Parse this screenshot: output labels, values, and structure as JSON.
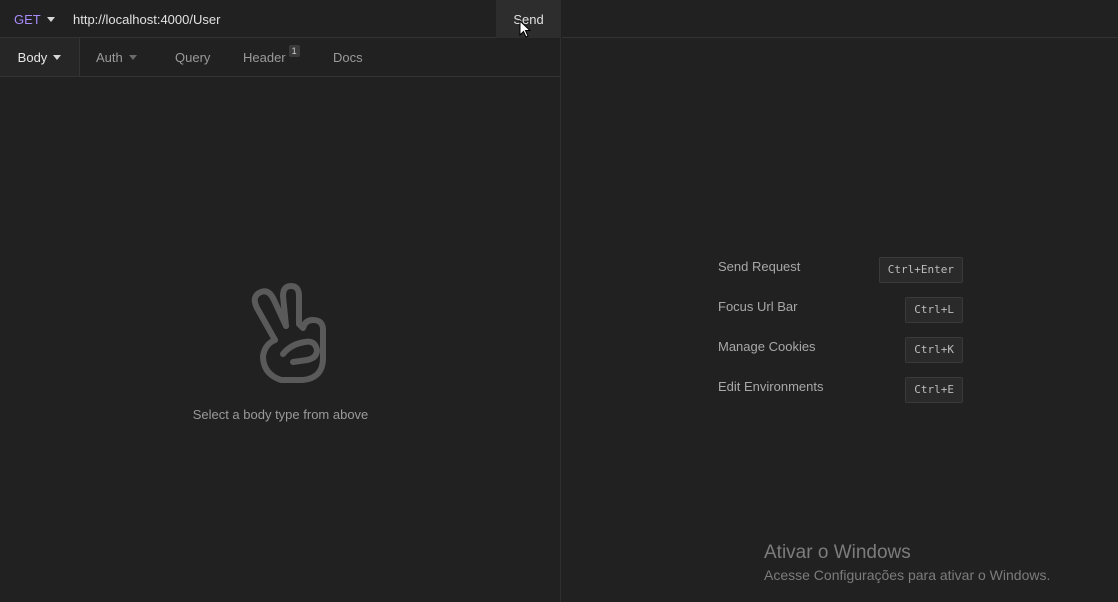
{
  "request": {
    "method": "GET",
    "url": "http://localhost:4000/User",
    "send_label": "Send"
  },
  "tabs": [
    {
      "label": "Body",
      "active": true
    },
    {
      "label": "Auth"
    },
    {
      "label": "Query"
    },
    {
      "label": "Header",
      "badge": "1"
    },
    {
      "label": "Docs"
    }
  ],
  "body_empty": {
    "icon": "peace-hand-icon",
    "text": "Select a body type from above"
  },
  "shortcuts": [
    {
      "label": "Send Request",
      "keys": "Ctrl+Enter"
    },
    {
      "label": "Focus Url Bar",
      "keys": "Ctrl+L"
    },
    {
      "label": "Manage Cookies",
      "keys": "Ctrl+K"
    },
    {
      "label": "Edit Environments",
      "keys": "Ctrl+E"
    }
  ],
  "watermark": {
    "title": "Ativar o Windows",
    "subtitle": "Acesse Configurações para ativar o Windows."
  },
  "colors": {
    "background": "#212121",
    "method_get": "#a78bfa",
    "border": "#333333"
  }
}
